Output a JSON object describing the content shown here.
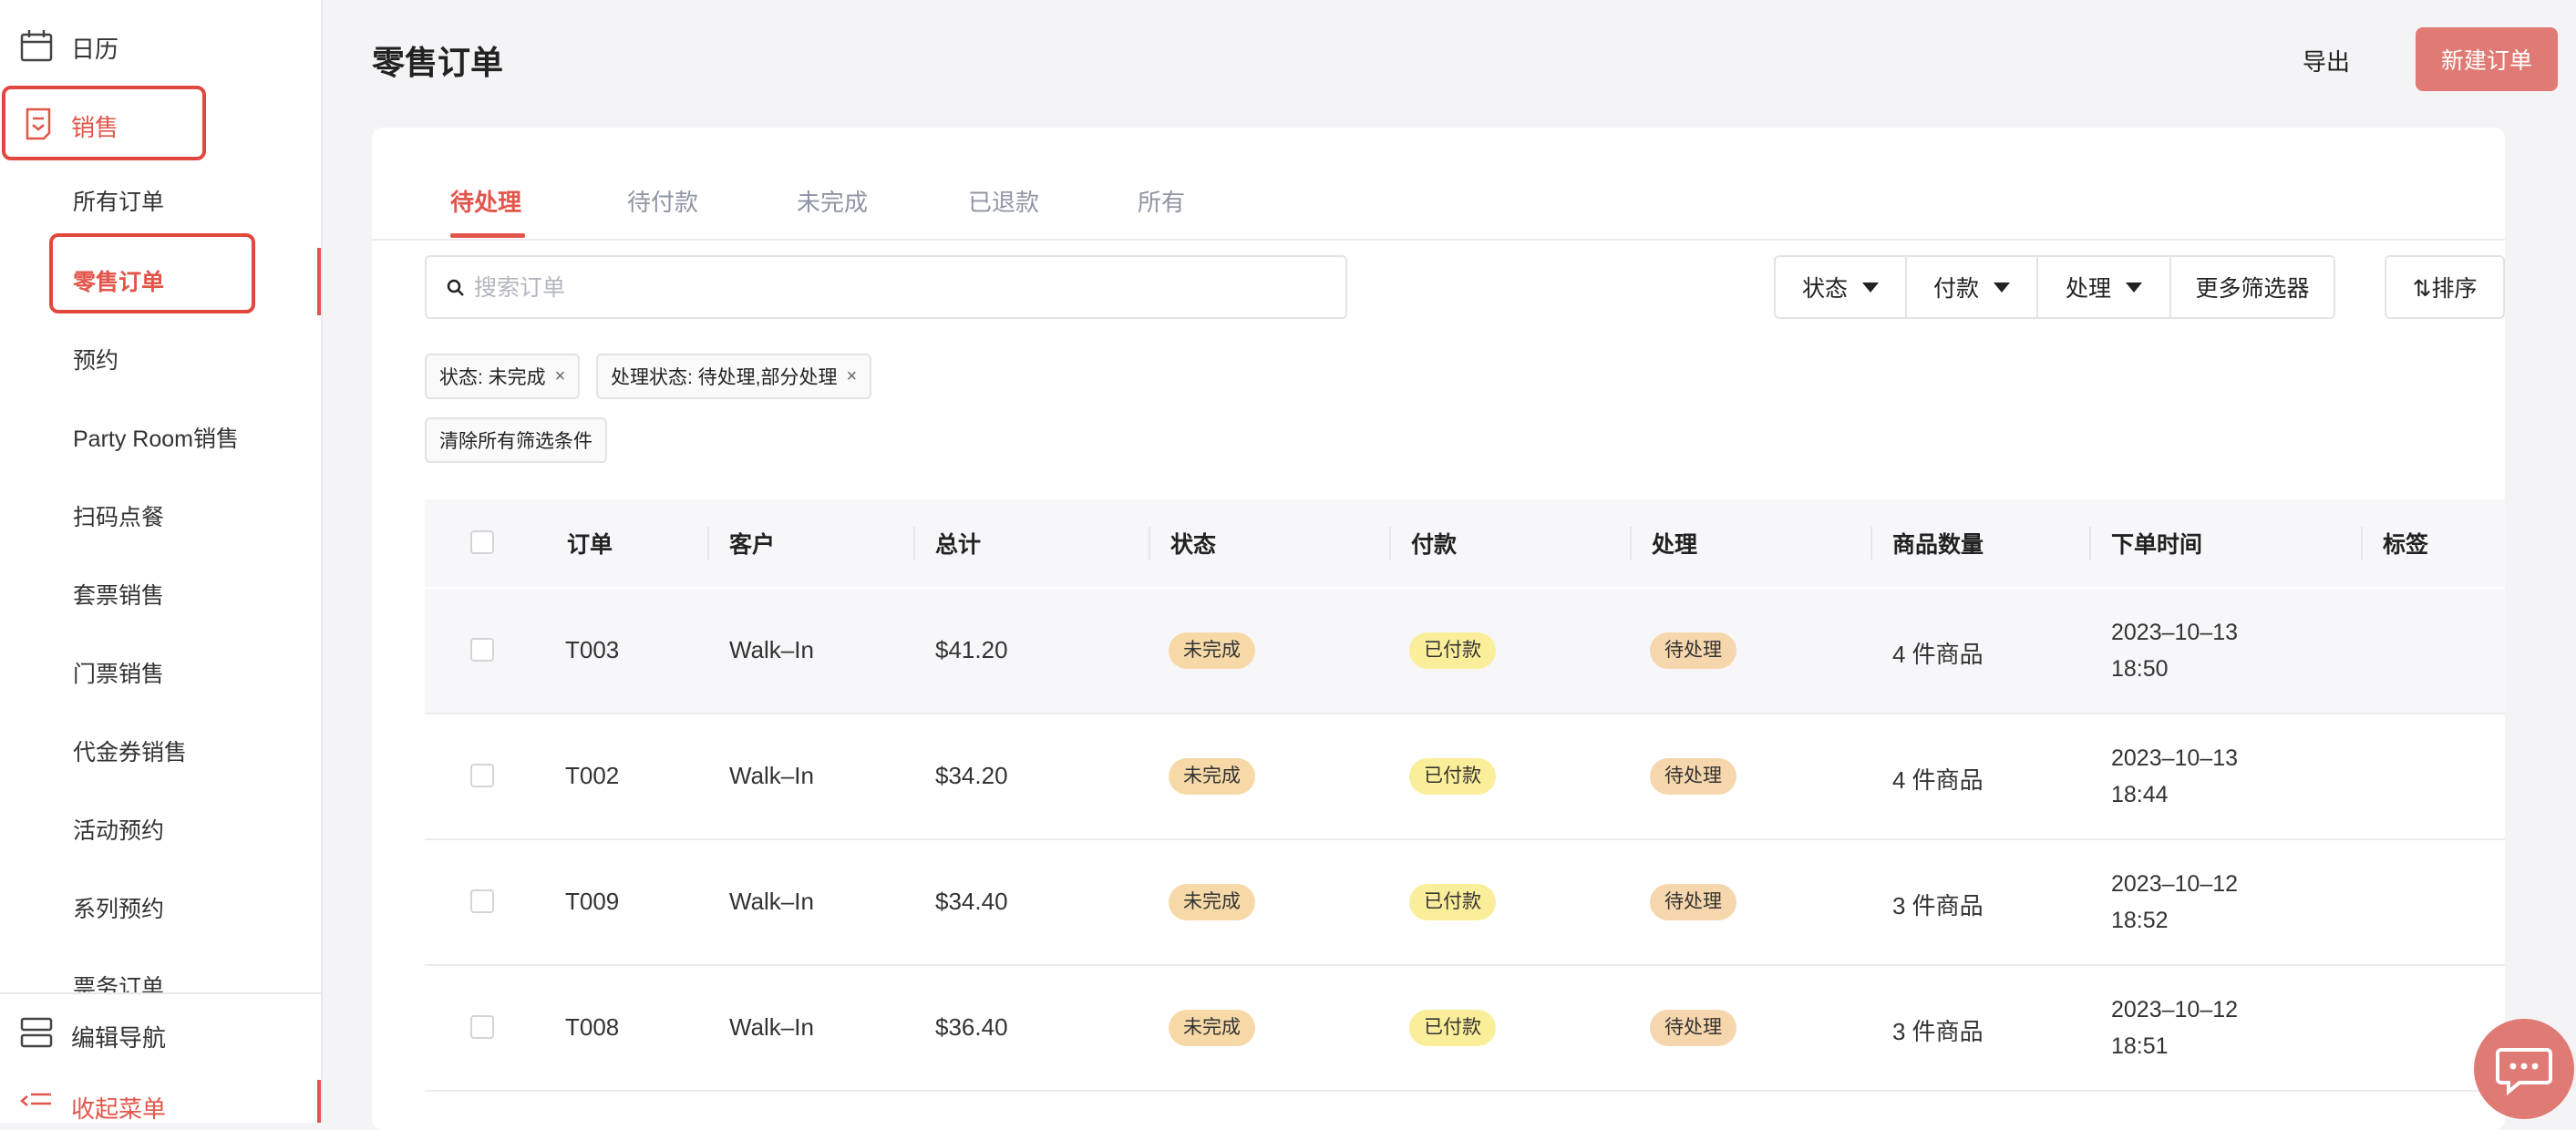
{
  "sidebar": {
    "top_item": "日历",
    "sales": "销售",
    "sub_items": [
      "所有订单",
      "零售订单",
      "预约",
      "Party Room销售",
      "扫码点餐",
      "套票销售",
      "门票销售",
      "代金券销售",
      "活动预约",
      "系列预约",
      "票务订单"
    ],
    "active_item": "零售订单",
    "bottom": {
      "edit_nav": "编辑导航",
      "collapse": "收起菜单"
    }
  },
  "header": {
    "title": "零售订单",
    "export": "导出",
    "new_order": "新建订单"
  },
  "tabs": [
    "待处理",
    "待付款",
    "未完成",
    "已退款",
    "所有"
  ],
  "active_tab": "待处理",
  "search": {
    "placeholder": "搜索订单",
    "value": ""
  },
  "filters": {
    "status": "状态",
    "payment": "付款",
    "process": "处理",
    "more": "更多筛选器",
    "sort": "⇅排序"
  },
  "chips": [
    "状态: 未完成",
    "处理状态: 待处理,部分处理"
  ],
  "chip_close": "×",
  "clear_filters": "清除所有筛选条件",
  "table": {
    "headers": [
      "订单",
      "客户",
      "总计",
      "状态",
      "付款",
      "处理",
      "商品数量",
      "下单时间",
      "标签"
    ],
    "rows": [
      {
        "order": "T003",
        "customer": "Walk–In",
        "total": "$41.20",
        "status": "未完成",
        "payment": "已付款",
        "process": "待处理",
        "items": "4 件商品",
        "date": "2023–10–13",
        "time": "18:50"
      },
      {
        "order": "T002",
        "customer": "Walk–In",
        "total": "$34.20",
        "status": "未完成",
        "payment": "已付款",
        "process": "待处理",
        "items": "4 件商品",
        "date": "2023–10–13",
        "time": "18:44"
      },
      {
        "order": "T009",
        "customer": "Walk–In",
        "total": "$34.40",
        "status": "未完成",
        "payment": "已付款",
        "process": "待处理",
        "items": "3 件商品",
        "date": "2023–10–12",
        "time": "18:52"
      },
      {
        "order": "T008",
        "customer": "Walk–In",
        "total": "$36.40",
        "status": "未完成",
        "payment": "已付款",
        "process": "待处理",
        "items": "3 件商品",
        "date": "2023–10–12",
        "time": "18:51"
      }
    ]
  },
  "colors": {
    "accent": "#e2554a",
    "button": "#e07a74",
    "highlight_box": "#e2473d"
  }
}
